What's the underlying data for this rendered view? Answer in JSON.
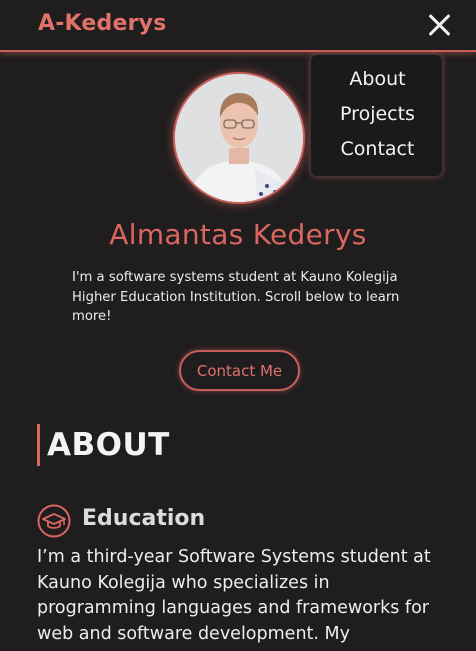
{
  "header": {
    "brand": "A-Kederys",
    "close_icon": "close-icon"
  },
  "nav": {
    "items": [
      {
        "label": "About"
      },
      {
        "label": "Projects"
      },
      {
        "label": "Contact"
      }
    ]
  },
  "hero": {
    "name": "Almantas Kederys",
    "bio": "I'm a software systems student at Kauno Kolegija Higher Education Institution. Scroll below to learn more!",
    "contact_button": "Contact Me"
  },
  "about": {
    "title": "ABOUT",
    "education": {
      "icon": "graduation-cap-icon",
      "title": "Education",
      "text": "I’m a third-year Software Systems student at Kauno Kolegija who specializes in programming languages and frameworks for web and software development. My"
    }
  },
  "colors": {
    "background": "#1f1d1e",
    "accent": "#d9675f",
    "text": "#eeeeee"
  }
}
